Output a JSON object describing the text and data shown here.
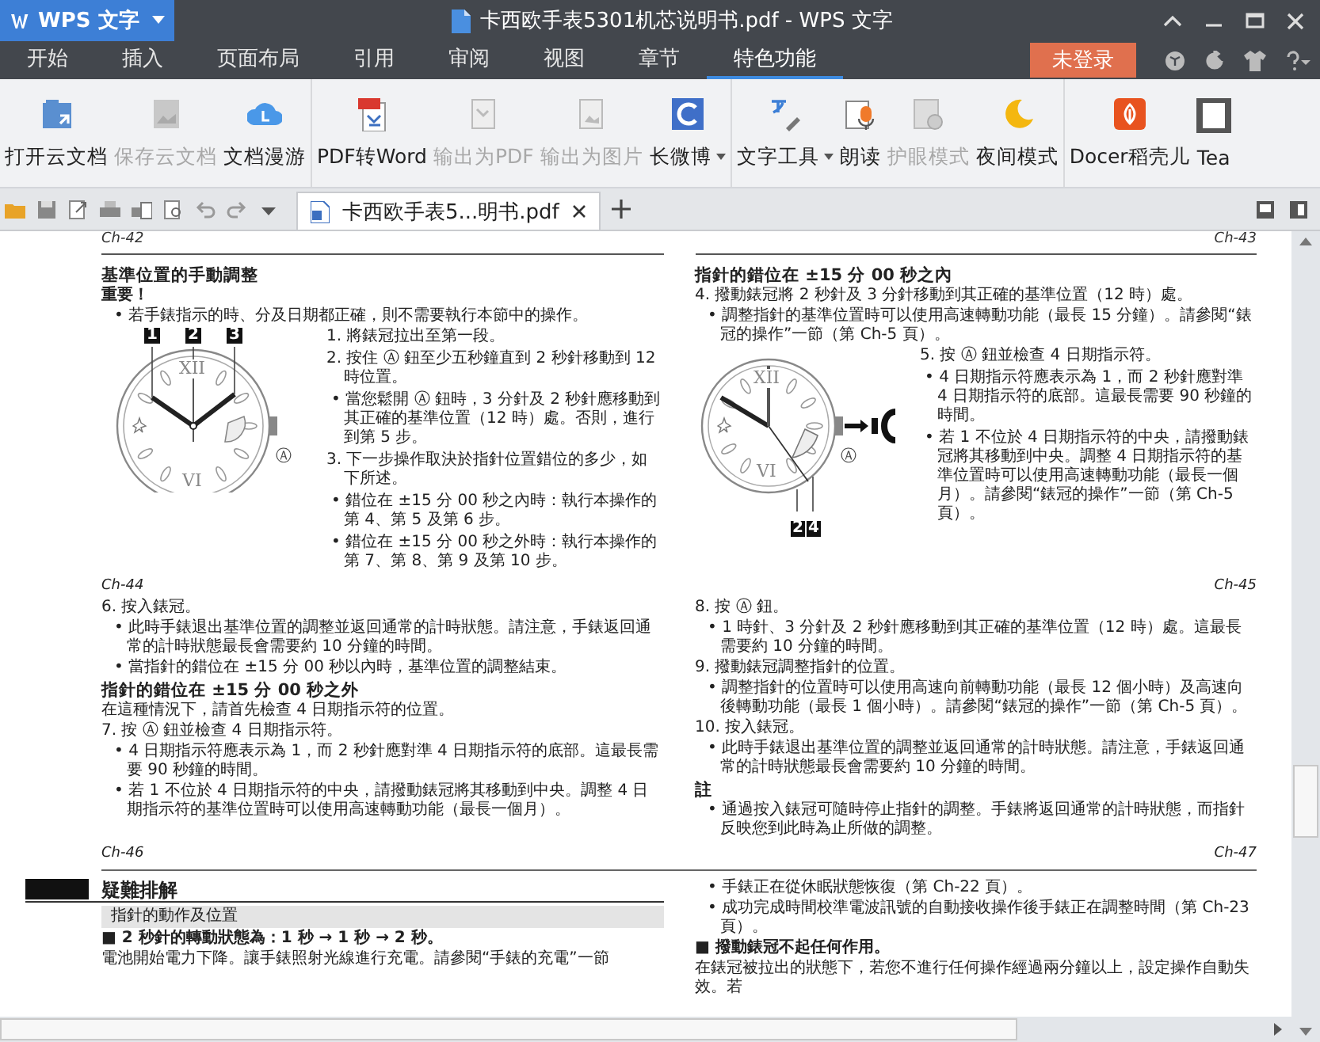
{
  "title_bar": {
    "app_menu": "WPS 文字",
    "title": "卡西欧手表5301机芯说明书.pdf - WPS 文字"
  },
  "menu_tabs": [
    {
      "label": "开始",
      "selected": false
    },
    {
      "label": "插入",
      "selected": false
    },
    {
      "label": "页面布局",
      "selected": false
    },
    {
      "label": "引用",
      "selected": false
    },
    {
      "label": "审阅",
      "selected": false
    },
    {
      "label": "视图",
      "selected": false
    },
    {
      "label": "章节",
      "selected": false
    },
    {
      "label": "特色功能",
      "selected": true
    }
  ],
  "account": {
    "login": "未登录"
  },
  "ribbon": {
    "groups": [
      [
        {
          "label": "打开云文档",
          "disabled": false,
          "dropdown": false
        },
        {
          "label": "保存云文档",
          "disabled": true,
          "dropdown": false
        },
        {
          "label": "文档漫游",
          "disabled": false,
          "dropdown": false
        }
      ],
      [
        {
          "label": "PDF转Word",
          "disabled": false,
          "dropdown": false
        },
        {
          "label": "输出为PDF",
          "disabled": true,
          "dropdown": false
        },
        {
          "label": "输出为图片",
          "disabled": true,
          "dropdown": false
        },
        {
          "label": "长微博",
          "disabled": false,
          "dropdown": true
        }
      ],
      [
        {
          "label": "文字工具",
          "disabled": false,
          "dropdown": true
        },
        {
          "label": "朗读",
          "disabled": false,
          "dropdown": false
        },
        {
          "label": "护眼模式",
          "disabled": true,
          "dropdown": false
        },
        {
          "label": "夜间模式",
          "disabled": false,
          "dropdown": false
        }
      ],
      [
        {
          "label": "Docer稻壳儿",
          "disabled": false,
          "dropdown": false
        },
        {
          "label": "Tea",
          "disabled": false,
          "dropdown": false
        }
      ]
    ]
  },
  "document_tab": {
    "label": "卡西欧手表5...明书.pdf"
  },
  "spreads": [
    {
      "columns": [
        {
          "header": "Ch-42",
          "footer": "Ch-44",
          "blocks": [
            {
              "kind": "heading",
              "text": "基準位置的手動調整"
            },
            {
              "kind": "label",
              "text": "重要！"
            },
            {
              "kind": "bullet",
              "text": "• 若手錶指示的時、分及日期都正確，則不需要執行本節中的操作。"
            },
            {
              "kind": "figure",
              "callouts": [
                "1",
                "2",
                "3"
              ],
              "dial": [
                "XII",
                "VI"
              ],
              "button": "Ⓐ",
              "beside": [
                {
                  "kind": "step",
                  "text": "1. 將錶冠拉出至第一段。"
                },
                {
                  "kind": "step",
                  "text": "2. 按住 Ⓐ 鈕至少五秒鐘直到 2 秒針移動到 12 時位置。"
                },
                {
                  "kind": "bullet",
                  "text": "• 當您鬆開 Ⓐ 鈕時，3 分針及 2 秒針應移動到其正確的基準位置（12 時）處。否則，進行到第 5 步。"
                },
                {
                  "kind": "step",
                  "text": "3. 下一步操作取決於指針位置錯位的多少，如下所述。"
                },
                {
                  "kind": "bullet",
                  "text": "• 錯位在 ±15 分 00 秒之內時：執行本操作的第 4、第 5 及第 6 步。"
                },
                {
                  "kind": "bullet",
                  "text": "• 錯位在 ±15 分 00 秒之外時：執行本操作的第 7、第 8、第 9 及第 10 步。"
                }
              ]
            }
          ]
        },
        {
          "header": "Ch-43",
          "footer": "Ch-45",
          "blocks": [
            {
              "kind": "heading",
              "text": "指針的錯位在 ±15 分 00 秒之內"
            },
            {
              "kind": "step",
              "text": "4. 撥動錶冠將 2 秒針及 3 分針移動到其正確的基準位置（12 時）處。"
            },
            {
              "kind": "bullet",
              "text": "• 調整指針的基準位置時可以使用高速轉動功能（最長 15 分鐘）。請參閱“錶冠的操作”一節（第 Ch-5 頁）。"
            },
            {
              "kind": "figure",
              "callouts": [
                "2",
                "4"
              ],
              "dial": [
                "XII",
                "VI"
              ],
              "button": "Ⓐ",
              "beside": [
                {
                  "kind": "step",
                  "text": "5. 按 Ⓐ 鈕並檢查 4 日期指示符。"
                },
                {
                  "kind": "bullet",
                  "text": "• 4 日期指示符應表示為 1，而 2 秒針應對準 4 日期指示符的底部。這最長需要 90 秒鐘的時間。"
                },
                {
                  "kind": "bullet",
                  "text": "• 若 1 不位於 4 日期指示符的中央，請撥動錶冠將其移動到中央。調整 4 日期指示符的基準位置時可以使用高速轉動功能（最長一個月）。請參閱“錶冠的操作”一節（第 Ch-5 頁）。"
                }
              ]
            }
          ]
        }
      ]
    },
    {
      "columns": [
        {
          "footer": "Ch-46",
          "blocks": [
            {
              "kind": "step",
              "text": "6. 按入錶冠。"
            },
            {
              "kind": "bullet",
              "text": "• 此時手錶退出基準位置的調整並返回通常的計時狀態。請注意，手錶返回通常的計時狀態最長會需要約 10 分鐘的時間。"
            },
            {
              "kind": "bullet",
              "text": "• 當指針的錯位在 ±15 分 00 秒以內時，基準位置的調整結束。"
            },
            {
              "kind": "heading",
              "text": "指針的錯位在 ±15 分 00 秒之外"
            },
            {
              "kind": "para",
              "text": "在這種情況下，請首先檢查 4 日期指示符的位置。"
            },
            {
              "kind": "step",
              "text": "7. 按 Ⓐ 鈕並檢查 4 日期指示符。"
            },
            {
              "kind": "bullet",
              "text": "• 4 日期指示符應表示為 1，而 2 秒針應對準 4 日期指示符的底部。這最長需要 90 秒鐘的時間。"
            },
            {
              "kind": "bullet",
              "text": "• 若 1 不位於 4 日期指示符的中央，請撥動錶冠將其移動到中央。調整 4 日期指示符的基準位置時可以使用高速轉動功能（最長一個月）。"
            }
          ]
        },
        {
          "footer": "Ch-47",
          "blocks": [
            {
              "kind": "step",
              "text": "8. 按 Ⓐ 鈕。"
            },
            {
              "kind": "bullet",
              "text": "• 1 時針、3 分針及 2 秒針應移動到其正確的基準位置（12 時）處。這最長需要約 10 分鐘的時間。"
            },
            {
              "kind": "step",
              "text": "9. 撥動錶冠調整指針的位置。"
            },
            {
              "kind": "bullet",
              "text": "• 調整指針的位置時可以使用高速向前轉動功能（最長 12 個小時）及高速向後轉動功能（最長 1 個小時）。請參閱“錶冠的操作”一節（第 Ch-5 頁）。"
            },
            {
              "kind": "step",
              "text": "10. 按入錶冠。"
            },
            {
              "kind": "bullet",
              "text": "• 此時手錶退出基準位置的調整並返回通常的計時狀態。請注意，手錶返回通常的計時狀態最長會需要約 10 分鐘的時間。"
            },
            {
              "kind": "heading",
              "text": "註"
            },
            {
              "kind": "bullet",
              "text": "• 通過按入錶冠可隨時停止指針的調整。手錶將返回通常的計時狀態，而指針反映您到此時為止所做的調整。"
            }
          ]
        }
      ]
    },
    {
      "columns": [
        {
          "blocks": [
            {
              "kind": "section",
              "text": "疑難排解"
            },
            {
              "kind": "subheading",
              "text": "指針的動作及位置"
            },
            {
              "kind": "problem",
              "text": "■ 2 秒針的轉動狀態為：1 秒 → 1 秒 → 2 秒。"
            },
            {
              "kind": "para",
              "text": "電池開始電力下降。讓手錶照射光線進行充電。請參閱“手錶的充電”一節"
            }
          ]
        },
        {
          "blocks": [
            {
              "kind": "bullet",
              "text": "• 手錶正在從休眠狀態恢復（第 Ch-22 頁）。"
            },
            {
              "kind": "bullet",
              "text": "• 成功完成時間校準電波訊號的自動接收操作後手錶正在調整時間（第 Ch-23 頁）。"
            },
            {
              "kind": "problem",
              "text": "■ 撥動錶冠不起任何作用。"
            },
            {
              "kind": "para",
              "text": "在錶冠被拉出的狀態下，若您不進行任何操作經過兩分鐘以上，設定操作自動失效。若"
            }
          ]
        }
      ]
    }
  ]
}
